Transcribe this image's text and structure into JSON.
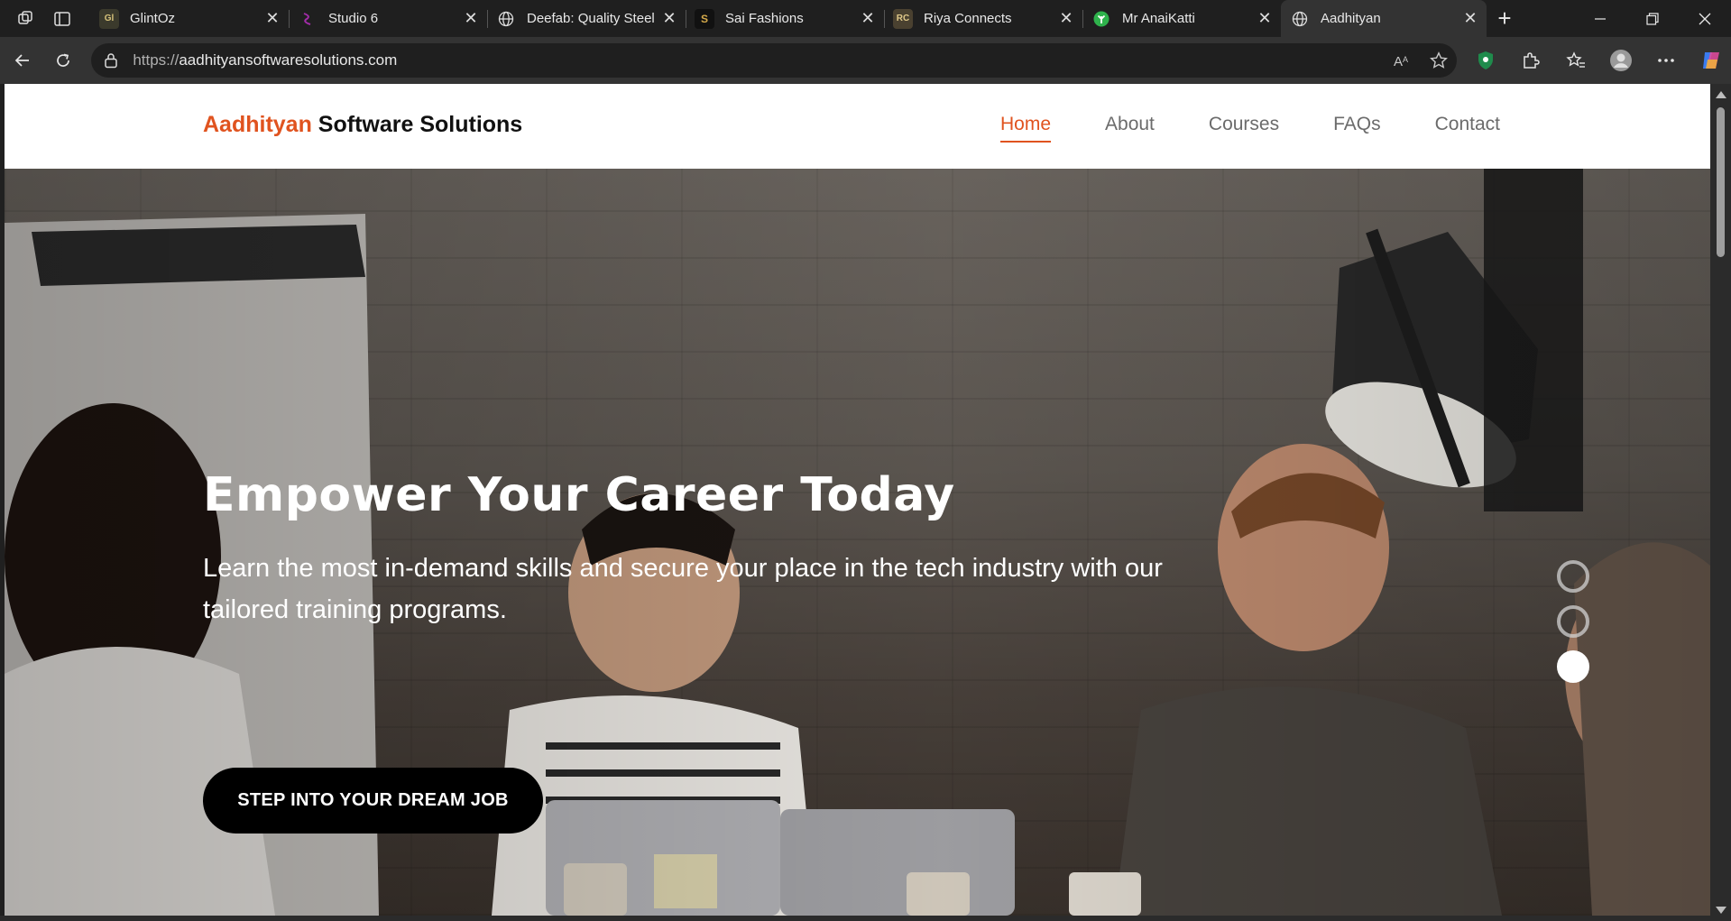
{
  "browser": {
    "tabs": [
      {
        "title": "GlintOz",
        "favicon": "glintoz-logo-icon",
        "active": false
      },
      {
        "title": "Studio 6",
        "favicon": "studio6-logo-icon",
        "active": false
      },
      {
        "title": "Deefab: Quality Steel",
        "favicon": "globe-icon",
        "active": false
      },
      {
        "title": "Sai Fashions",
        "favicon": "sai-fashions-logo-icon",
        "active": false
      },
      {
        "title": "Riya Connects",
        "favicon": "riya-connects-logo-icon",
        "active": false
      },
      {
        "title": "Mr AnaiKatti",
        "favicon": "leaf-logo-icon",
        "active": false
      },
      {
        "title": "Aadhityan",
        "favicon": "globe-icon",
        "active": true
      }
    ],
    "close_glyph": "✕",
    "new_tab_glyph": "+",
    "url_scheme": "https://",
    "url_host": "aadhityansoftwaresolutions.com"
  },
  "site": {
    "brand_accent": "Aadhityan",
    "brand_rest": " Software Solutions",
    "nav": [
      {
        "label": "Home",
        "active": true
      },
      {
        "label": "About",
        "active": false
      },
      {
        "label": "Courses",
        "active": false
      },
      {
        "label": "FAQs",
        "active": false
      },
      {
        "label": "Contact",
        "active": false
      }
    ],
    "hero": {
      "title": "Empower Your Career Today",
      "subtitle": "Learn the most in-demand skills and secure your place in the tech industry with our tailored training programs.",
      "cta": "STEP INTO YOUR DREAM JOB",
      "slides_count": 3,
      "active_slide": 3
    },
    "colors": {
      "accent": "#e0531f",
      "cta_bg": "#000000",
      "header_bg": "#ffffff"
    }
  }
}
